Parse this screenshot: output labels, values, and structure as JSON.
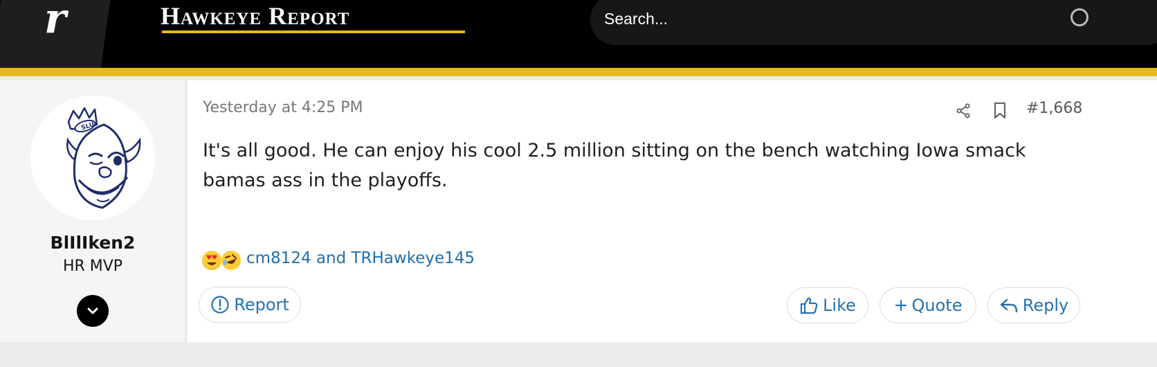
{
  "header": {
    "logo_letter": "r",
    "site_title": "Hawkeye Report",
    "search_placeholder": "Search..."
  },
  "colors": {
    "accent_gold": "#e5b91e",
    "link_blue": "#2471b4"
  },
  "post": {
    "author": {
      "username": "BlIlIken2",
      "title": "HR MVP"
    },
    "date": "Yesterday at 4:25 PM",
    "number": "#1,668",
    "body": "It's all good. He can enjoy his cool 2.5 million sitting on the bench watching Iowa smack bamas ass in the playoffs.",
    "reactions": {
      "icons": [
        "heart-eyes-emoji",
        "rofl-emoji"
      ],
      "users_text": "cm8124 and TRHawkeye145"
    },
    "actions": {
      "report": "Report",
      "like": "Like",
      "quote": "Quote",
      "reply": "Reply"
    }
  }
}
